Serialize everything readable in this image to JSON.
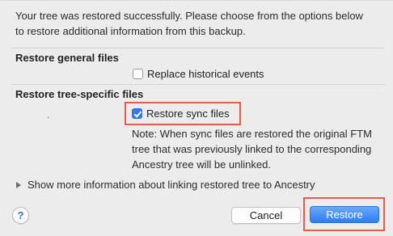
{
  "intro_text": "Your tree was restored successfully. Please choose from the options below to restore additional information from this backup.",
  "sections": {
    "general": {
      "title": "Restore general files",
      "options": [
        {
          "label": "Replace historical events",
          "checked": false
        }
      ]
    },
    "tree_specific": {
      "title": "Restore tree-specific files",
      "options": [
        {
          "label": "Restore sync files",
          "checked": true
        }
      ],
      "marker": ".",
      "note": "Note: When sync files are restored the original FTM tree that was previously linked to the corresponding Ancestry tree will be unlinked."
    }
  },
  "disclosure": {
    "label": "Show more information about linking restored tree to Ancestry",
    "expanded": false
  },
  "buttons": {
    "help": "?",
    "cancel": "Cancel",
    "restore": "Restore"
  },
  "colors": {
    "accent": "#2f7bf5",
    "highlight": "#e25d49",
    "background": "#ececec"
  }
}
